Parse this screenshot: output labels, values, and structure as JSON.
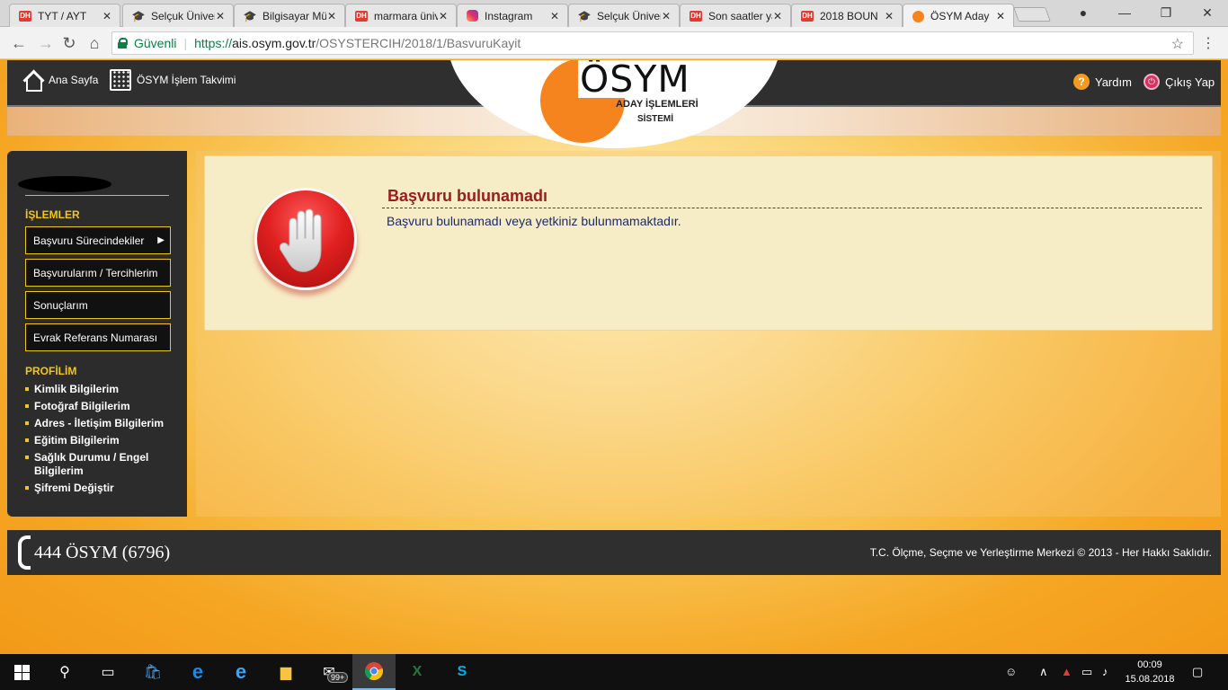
{
  "browser": {
    "tabs": [
      {
        "title": "TYT / AYT",
        "favicon": "dh-icon"
      },
      {
        "title": "Selçuk Üniversitesi",
        "favicon": "graduation-cap-icon"
      },
      {
        "title": "Bilgisayar Mühendisliği",
        "favicon": "graduation-cap-icon"
      },
      {
        "title": "marmara üniversitesi",
        "favicon": "dh-icon"
      },
      {
        "title": "Instagram",
        "favicon": "instagram-icon"
      },
      {
        "title": "Selçuk Üniversitesi",
        "favicon": "graduation-cap-icon"
      },
      {
        "title": "Son saatler yaklaşıyor",
        "favicon": "dh-icon"
      },
      {
        "title": "2018 BOUN",
        "favicon": "dh-icon"
      },
      {
        "title": "ÖSYM Aday",
        "favicon": "osym-icon",
        "active": true
      }
    ],
    "dh_label": "DH",
    "close_glyph": "✕",
    "secure_label": "Güvenli",
    "url_scheme": "https://",
    "url_host": "ais.osym.gov.tr",
    "url_path": "/OSYSTERCIH/2018/1/BasvuruKayit"
  },
  "header": {
    "home_label": "Ana Sayfa",
    "calendar_label": "ÖSYM İşlem Takvimi",
    "help_label": "Yardım",
    "logout_label": "Çıkış Yap",
    "logo_text": "ÖSYM",
    "logo_sub1": "ADAY İŞLEMLERİ",
    "logo_sub2": "SİSTEMİ"
  },
  "sidebar": {
    "operations_heading": "İŞLEMLER",
    "operations": [
      {
        "label": "Başvuru Sürecindekiler",
        "has_arrow": true
      },
      {
        "label": "Başvurularım / Tercihlerim"
      },
      {
        "label": "Sonuçlarım"
      },
      {
        "label": "Evrak Referans Numarası"
      }
    ],
    "profile_heading": "PROFİLİM",
    "profile": [
      {
        "label": "Kimlik Bilgilerim"
      },
      {
        "label": "Fotoğraf Bilgilerim"
      },
      {
        "label": "Adres - İletişim Bilgilerim"
      },
      {
        "label": "Eğitim Bilgilerim"
      },
      {
        "label": "Sağlık Durumu / Engel Bilgilerim"
      },
      {
        "label": "Şifremi Değiştir"
      }
    ]
  },
  "message": {
    "title": "Başvuru bulunamadı",
    "text": "Başvuru bulunamadı veya yetkiniz bulunmamaktadır.",
    "icon": "stop-hand-icon"
  },
  "footer": {
    "phone": "444 ÖSYM (6796)",
    "copyright": "T.C. Ölçme, Seçme ve Yerleştirme Merkezi © 2013 - Her Hakkı Saklıdır."
  },
  "taskbar": {
    "mail_badge": "99+",
    "time": "00:09",
    "date": "15.08.2018"
  },
  "colors": {
    "accent_orange": "#f5841f",
    "sidebar_bg": "#2c2c2c",
    "sidebar_accent": "#f5c518",
    "error_title": "#9b1c1c"
  }
}
